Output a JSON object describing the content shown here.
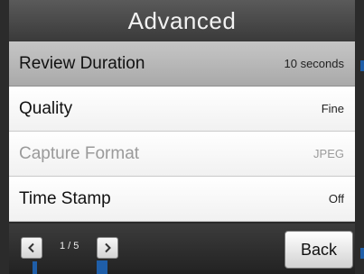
{
  "header": {
    "title": "Advanced"
  },
  "settings": [
    {
      "label": "Review Duration",
      "value": "10 seconds",
      "selected": true,
      "enabled": true
    },
    {
      "label": "Quality",
      "value": "Fine",
      "selected": false,
      "enabled": true
    },
    {
      "label": "Capture Format",
      "value": "JPEG",
      "selected": false,
      "enabled": false
    },
    {
      "label": "Time Stamp",
      "value": "Off",
      "selected": false,
      "enabled": true
    }
  ],
  "footer": {
    "prev_icon": "chevron-left-icon",
    "next_icon": "chevron-right-icon",
    "page_indicator": "1 / 5",
    "back_label": "Back"
  },
  "colors": {
    "marker": "#1f5ea8",
    "selected_row": "#b5b5b5",
    "disabled_text": "#9a9a9a"
  }
}
